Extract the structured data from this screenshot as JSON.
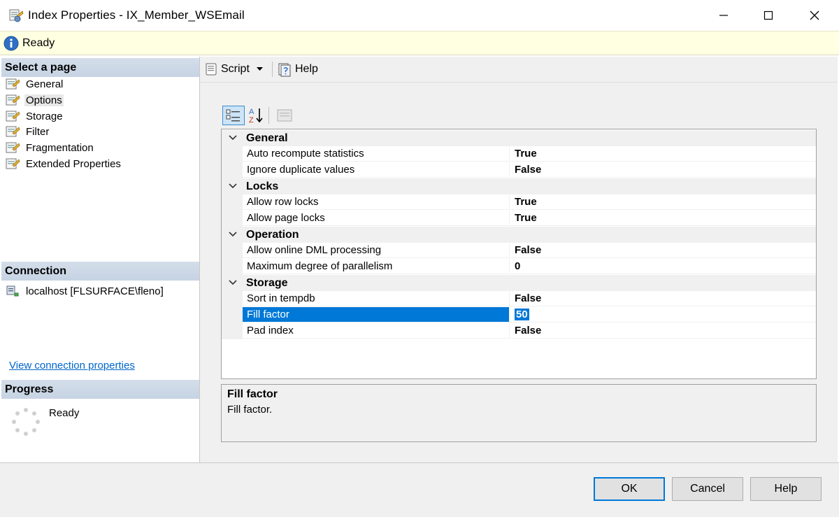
{
  "window": {
    "title": "Index Properties - IX_Member_WSEmail",
    "minimize_icon": "minimize-icon",
    "maximize_icon": "maximize-icon",
    "close_icon": "close-icon"
  },
  "status": {
    "icon": "info-icon",
    "text": "Ready"
  },
  "left": {
    "select_page_header": "Select a page",
    "pages": [
      {
        "label": "General",
        "icon": "page-icon"
      },
      {
        "label": "Options",
        "icon": "page-icon",
        "selected": true
      },
      {
        "label": "Storage",
        "icon": "page-icon"
      },
      {
        "label": "Filter",
        "icon": "page-icon"
      },
      {
        "label": "Fragmentation",
        "icon": "page-icon"
      },
      {
        "label": "Extended Properties",
        "icon": "page-icon"
      }
    ],
    "connection_header": "Connection",
    "connection_name": "localhost [FLSURFACE\\fleno]",
    "view_connection_link": "View connection properties",
    "progress_header": "Progress",
    "progress_text": "Ready"
  },
  "toolbar": {
    "script_label": "Script",
    "help_label": "Help"
  },
  "grid": {
    "categories": [
      {
        "name": "General",
        "rows": [
          {
            "name": "Auto recompute statistics",
            "value": "True"
          },
          {
            "name": "Ignore duplicate values",
            "value": "False"
          }
        ]
      },
      {
        "name": "Locks",
        "rows": [
          {
            "name": "Allow row locks",
            "value": "True"
          },
          {
            "name": "Allow page locks",
            "value": "True"
          }
        ]
      },
      {
        "name": "Operation",
        "rows": [
          {
            "name": "Allow online DML processing",
            "value": "False"
          },
          {
            "name": "Maximum degree of parallelism",
            "value": "0"
          }
        ]
      },
      {
        "name": "Storage",
        "rows": [
          {
            "name": "Sort in tempdb",
            "value": "False"
          },
          {
            "name": "Fill factor",
            "value": "50",
            "selected": true
          },
          {
            "name": "Pad index",
            "value": "False"
          }
        ]
      }
    ]
  },
  "description": {
    "title": "Fill factor",
    "text": "Fill factor."
  },
  "buttons": {
    "ok": "OK",
    "cancel": "Cancel",
    "help": "Help"
  },
  "colors": {
    "selection": "#0078d7",
    "status_bg": "#ffffe1",
    "section_header": "#ccd8e6"
  }
}
